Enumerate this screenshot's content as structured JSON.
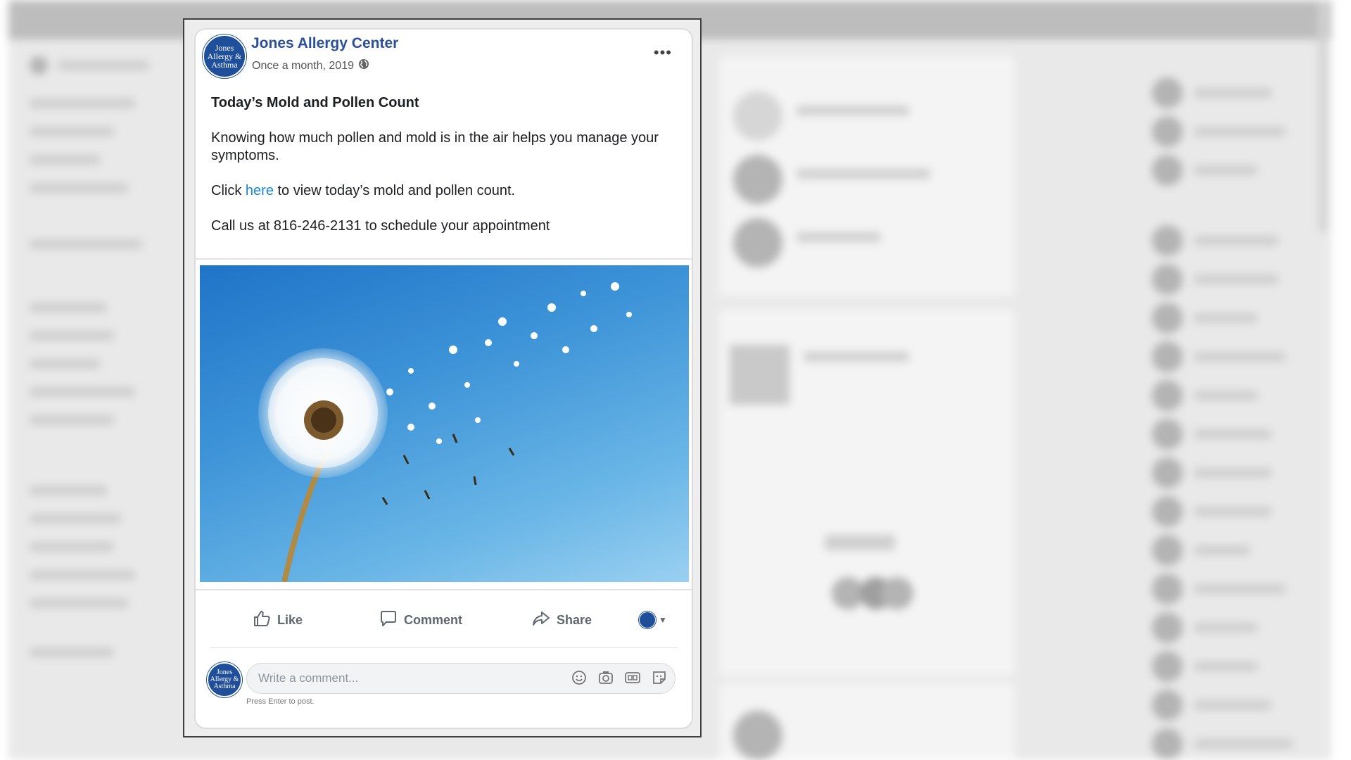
{
  "post": {
    "author": "Jones Allergy Center",
    "meta": "Once a month, 2019",
    "more_label": "•••",
    "avatar_text": "Jones Allergy & Asthma",
    "title": "Today’s Mold and Pollen Count",
    "paragraph_1": "Knowing how much pollen and mold is in the air helps you manage your symptoms.",
    "click_prefix": "Click",
    "link_text": "here",
    "click_suffix": "to view today’s mold and pollen count.",
    "call_text": "Call us at 816-246-2131 to schedule your appointment"
  },
  "actions": {
    "like_label": "Like",
    "comment_label": "Comment",
    "share_label": "Share"
  },
  "comment": {
    "placeholder": "Write a comment...",
    "hint": "Press Enter to post."
  },
  "colors": {
    "brand_blue": "#2a4f9c",
    "link_blue": "#1a86d3",
    "sky_blue": "#3f95d8"
  },
  "icons": {
    "globe": "globe-icon",
    "like": "thumbs-up-icon",
    "comment": "speech-bubble-icon",
    "share": "share-arrow-icon",
    "emoji": "smiley-icon",
    "camera": "camera-icon",
    "gif": "gif-icon",
    "sticker": "sticker-icon"
  }
}
